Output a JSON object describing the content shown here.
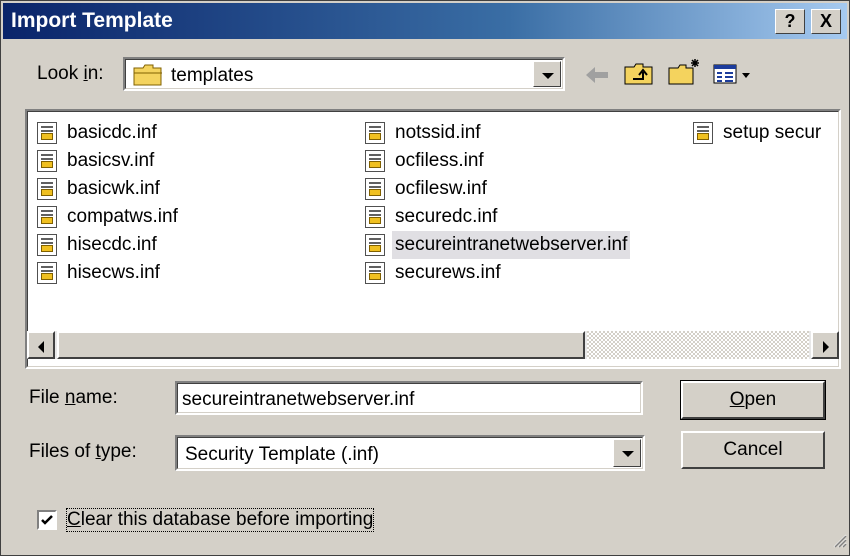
{
  "window": {
    "title": "Import Template",
    "help_label": "?",
    "close_label": "X"
  },
  "look_in": {
    "label_pre": "Look ",
    "label_key": "i",
    "label_post": "n:",
    "value": "templates"
  },
  "files": [
    {
      "name": "basicdc.inf"
    },
    {
      "name": "basicsv.inf"
    },
    {
      "name": "basicwk.inf"
    },
    {
      "name": "compatws.inf"
    },
    {
      "name": "hisecdc.inf"
    },
    {
      "name": "hisecws.inf"
    },
    {
      "name": "notssid.inf"
    },
    {
      "name": "ocfiless.inf"
    },
    {
      "name": "ocfilesw.inf"
    },
    {
      "name": "securedc.inf"
    },
    {
      "name": "secureintranetwebserver.inf",
      "selected": true
    },
    {
      "name": "securews.inf"
    },
    {
      "name": "setup secur"
    }
  ],
  "file_name": {
    "label_pre": "File ",
    "label_key": "n",
    "label_post": "ame:",
    "value": "secureintranetwebserver.inf"
  },
  "file_type": {
    "label_pre": "Files of ",
    "label_key": "t",
    "label_post": "ype:",
    "value": "Security Template (.inf)"
  },
  "buttons": {
    "open_key": "O",
    "open_rest": "pen",
    "cancel": "Cancel"
  },
  "checkbox": {
    "checked": true,
    "label_key": "C",
    "label_rest": "lear this database before importing"
  },
  "icons": {
    "back": "back-arrow-icon",
    "up": "up-folder-icon",
    "new_folder": "new-folder-icon",
    "view_menu": "view-menu-icon",
    "folder": "folder-icon",
    "file": "inf-file-icon"
  }
}
